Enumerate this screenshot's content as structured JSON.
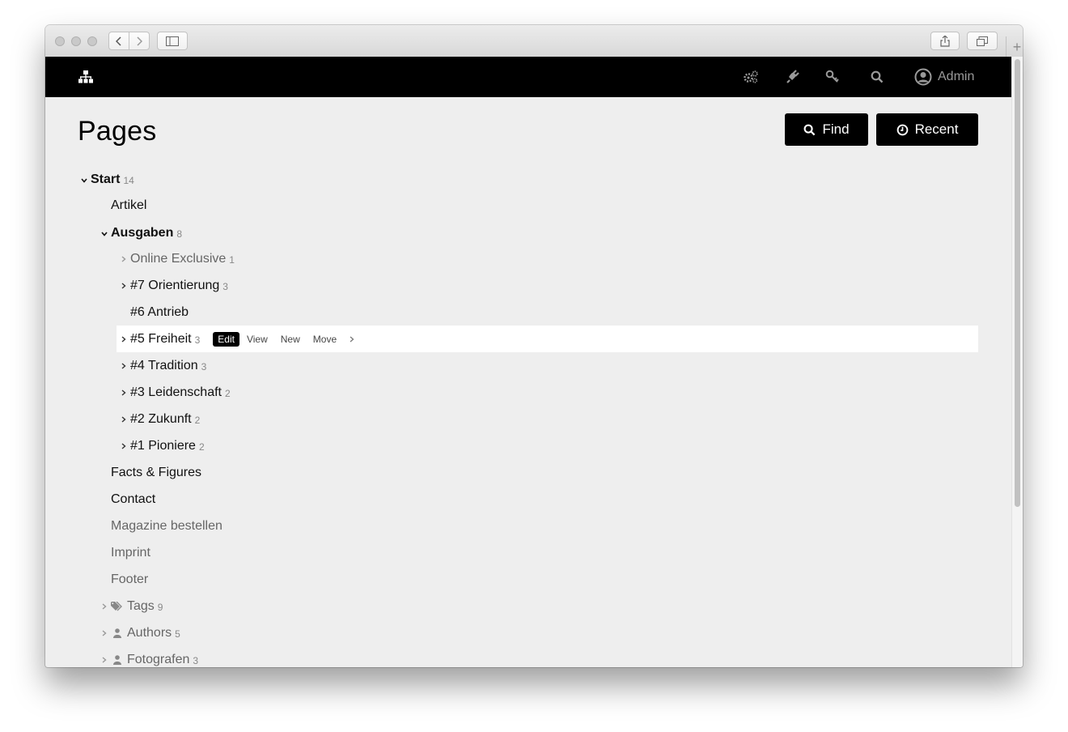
{
  "header": {
    "admin_label": "Admin"
  },
  "page": {
    "title": "Pages",
    "find_label": "Find",
    "recent_label": "Recent"
  },
  "tree": {
    "start": {
      "label": "Start",
      "count": "14"
    },
    "artikel": {
      "label": "Artikel"
    },
    "ausgaben": {
      "label": "Ausgaben",
      "count": "8"
    },
    "online_exclusive": {
      "label": "Online Exclusive",
      "count": "1"
    },
    "orientierung": {
      "label": "#7 Orientierung",
      "count": "3"
    },
    "antrieb": {
      "label": "#6 Antrieb"
    },
    "freiheit": {
      "label": "#5 Freiheit",
      "count": "3"
    },
    "tradition": {
      "label": "#4 Tradition",
      "count": "3"
    },
    "leidenschaft": {
      "label": "#3 Leidenschaft",
      "count": "2"
    },
    "zukunft": {
      "label": "#2 Zukunft",
      "count": "2"
    },
    "pioniere": {
      "label": "#1 Pioniere",
      "count": "2"
    },
    "facts": {
      "label": "Facts & Figures"
    },
    "contact": {
      "label": "Contact"
    },
    "magazine": {
      "label": "Magazine bestellen"
    },
    "imprint": {
      "label": "Imprint"
    },
    "footer": {
      "label": "Footer"
    },
    "tags": {
      "label": "Tags",
      "count": "9"
    },
    "authors": {
      "label": "Authors",
      "count": "5"
    },
    "fotografen": {
      "label": "Fotografen",
      "count": "3"
    }
  },
  "row_actions": {
    "edit": "Edit",
    "view": "View",
    "new": "New",
    "move": "Move"
  },
  "icons": {
    "logo": "sitemap-icon",
    "settings": "gears-icon",
    "plugins": "plug-icon",
    "keys": "key-icon",
    "search": "search-icon",
    "user": "user-circle-icon"
  }
}
